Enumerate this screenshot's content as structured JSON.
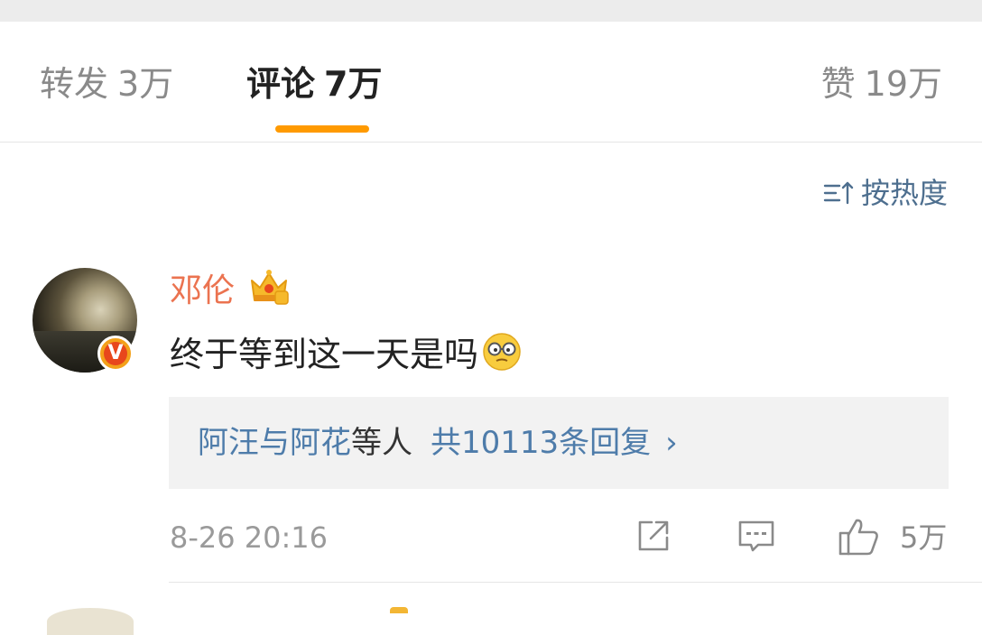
{
  "tabs": {
    "forward": {
      "label": "转发",
      "count": "3万"
    },
    "comment": {
      "label": "评论",
      "count": "7万"
    },
    "like": {
      "label": "赞",
      "count": "19万"
    }
  },
  "sort": {
    "label": "按热度",
    "icon": "sort-icon"
  },
  "comment": {
    "username": "邓伦",
    "verified_badge": "V",
    "content": "终于等到这一天是吗",
    "reply_summary": {
      "names": "阿汪与阿花",
      "suffix": "等人",
      "count_text": "共10113条回复",
      "chevron": "›"
    },
    "time": "8-26 20:16",
    "like_count": "5万"
  },
  "colors": {
    "accent": "#ff9a00",
    "username": "#eb7350",
    "link": "#4e7caa"
  }
}
